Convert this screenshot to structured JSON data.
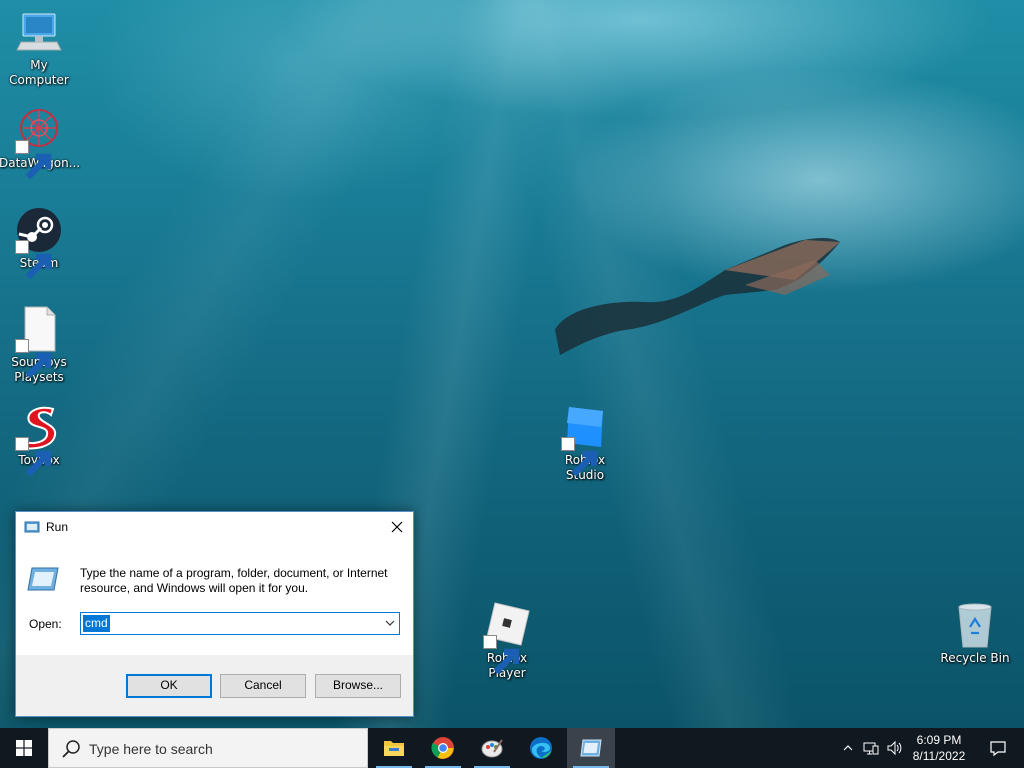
{
  "desktop": {
    "icons": [
      {
        "label": "My Computer",
        "icon": "computer-icon"
      },
      {
        "label": "DataWagon...",
        "icon": "datawagon-icon"
      },
      {
        "label": "Steam",
        "icon": "steam-icon"
      },
      {
        "label": "Souptoys Playsets",
        "icon": "blank-file-icon"
      },
      {
        "label": "Toybox",
        "icon": "toybox-icon"
      },
      {
        "label": "Roblox Studio",
        "icon": "roblox-studio-icon"
      },
      {
        "label": "Roblox Player",
        "icon": "roblox-player-icon"
      },
      {
        "label": "Recycle Bin",
        "icon": "recycle-bin-icon"
      }
    ]
  },
  "run_dialog": {
    "title": "Run",
    "description": "Type the name of a program, folder, document, or Internet resource, and Windows will open it for you.",
    "open_label": "Open:",
    "input_value": "cmd",
    "ok_label": "OK",
    "cancel_label": "Cancel",
    "browse_label": "Browse..."
  },
  "taskbar": {
    "search_placeholder": "Type here to search",
    "pinned_apps": [
      "file-explorer-icon",
      "chrome-icon",
      "paint-icon",
      "edge-icon",
      "run-icon"
    ],
    "active_app": "run-icon",
    "time": "6:09 PM",
    "date": "8/11/2022",
    "accent_color": "#0078d7"
  }
}
